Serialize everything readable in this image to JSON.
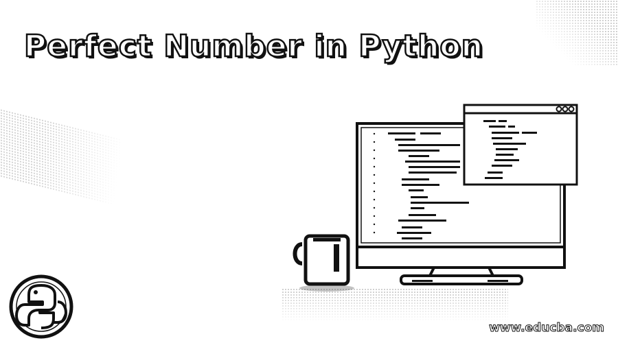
{
  "banner": {
    "title": "Perfect Number in Python",
    "website": "www.educba.com"
  },
  "icons": {
    "logo": "python-logo-icon",
    "monitor": "monitor-icon",
    "code_window": "code-window-icon",
    "mug": "coffee-mug-icon"
  },
  "colors": {
    "background": "#ffffff",
    "ink": "#111111",
    "dots": "#9a9a9a"
  }
}
